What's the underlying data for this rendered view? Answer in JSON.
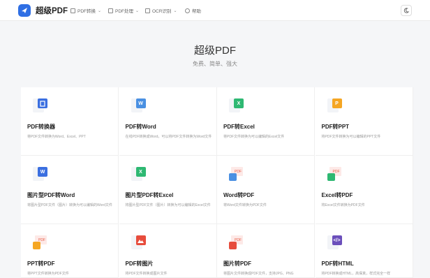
{
  "brand": "超级PDF",
  "nav": [
    {
      "label": "PDF转换",
      "icon": "document-icon",
      "chevron": "⌄"
    },
    {
      "label": "PDF处理",
      "icon": "document-icon",
      "chevron": "⌄"
    },
    {
      "label": "OCR识别",
      "icon": "scan-icon",
      "chevron": "⌄"
    },
    {
      "label": "帮助",
      "icon": "help-icon",
      "chevron": ""
    }
  ],
  "theme_toggle_icon": "moon-icon",
  "hero": {
    "title": "超级PDF",
    "subtitle": "免费、简单、强大"
  },
  "colors": {
    "office": "#3b6fe0",
    "word": "#4a90e2",
    "excel": "#2eb872",
    "ppt": "#f5a623",
    "pdf": "#e85c45",
    "image": "#e74c3c",
    "html": "#6b4fbb"
  },
  "cards": [
    {
      "title": "PDF转换器",
      "desc": "将PDF文件转换为Word、Excel、PPT",
      "icon": "office-icon",
      "badge": "",
      "color": "#3b6fe0"
    },
    {
      "title": "PDF转Word",
      "desc": "在线PDF转换成Word，可以将PDF文件转换为Word文件",
      "icon": "word-icon",
      "badge": "W",
      "color": "#4a90e2"
    },
    {
      "title": "PDF转Excel",
      "desc": "将PDF文件转换为可以编辑的Excel文件",
      "icon": "excel-icon",
      "badge": "X",
      "color": "#2eb872"
    },
    {
      "title": "PDF转PPT",
      "desc": "将PDF文件转换为可以编辑的PPT文件",
      "icon": "ppt-icon",
      "badge": "P",
      "color": "#f5a623"
    },
    {
      "title": "图片型PDF转Word",
      "desc": "将图片型PDF文件（图片）转换为可以编辑的Word文件",
      "icon": "word-icon",
      "badge": "W",
      "color": "#3b6fe0"
    },
    {
      "title": "图片型PDF转Excel",
      "desc": "将图片型PDF文件（图片）转换为可以编辑的Excel文件",
      "icon": "excel-icon",
      "badge": "X",
      "color": "#2eb872"
    },
    {
      "title": "Word转PDF",
      "desc": "将Word文件转换为PDF文件",
      "icon": "word-to-pdf-icon",
      "badge": "PDF",
      "color": "#4a90e2"
    },
    {
      "title": "Excel转PDF",
      "desc": "将Excel文件转换为PDF文件",
      "icon": "excel-to-pdf-icon",
      "badge": "PDF",
      "color": "#2eb872"
    },
    {
      "title": "PPT转PDF",
      "desc": "将PPT文件转换为PDF文件",
      "icon": "ppt-to-pdf-icon",
      "badge": "PDF",
      "color": "#f5a623"
    },
    {
      "title": "PDF转图片",
      "desc": "将PDF文件转换成图片文件",
      "icon": "image-icon",
      "badge": "",
      "color": "#e74c3c"
    },
    {
      "title": "图片转PDF",
      "desc": "将图片文件转换成PDF文件，支持JPG、PNG",
      "icon": "image-to-pdf-icon",
      "badge": "PDF",
      "color": "#e74c3c"
    },
    {
      "title": "PDF转HTML",
      "desc": "将PDF转换成HTML，高保真，样式完全一样",
      "icon": "code-icon",
      "badge": "</>",
      "color": "#6b4fbb"
    }
  ]
}
